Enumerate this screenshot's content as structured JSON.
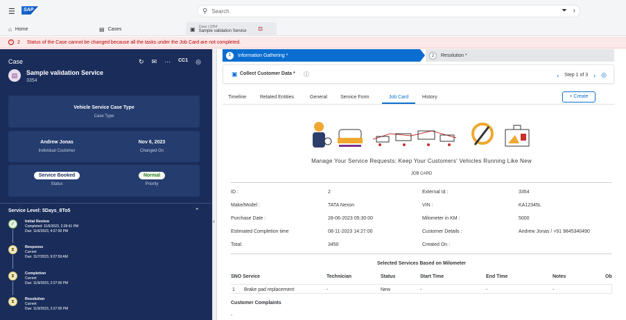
{
  "shell": {
    "search_placeholder": "Search",
    "logo": "SAP"
  },
  "tabs": [
    {
      "label": "Home",
      "icon": "home-icon"
    },
    {
      "label": "Cases",
      "icon": "cases-icon"
    },
    {
      "sub": "Case | 3354",
      "title": "Sample validation Service",
      "icon": "case-icon"
    }
  ],
  "error": {
    "count": "2",
    "message": "Status of the Case cannot be changed because all the tasks under the Job Card are not completed."
  },
  "case": {
    "header": "Case",
    "action_label": "CC1",
    "title": "Sample validation Service",
    "number": "3354",
    "type_value": "Vehicle Service Case Type",
    "type_label": "Case Type",
    "customer_value": "Andrew Jonas",
    "customer_label": "Individual Customer",
    "changed_value": "Nov 6, 2023",
    "changed_label": "Changed On",
    "status_value": "Service Booked",
    "status_label": "Status",
    "priority_value": "Normal",
    "priority_label": "Priority",
    "sla_title": "Service Level: 5Days_8To5",
    "steps": [
      {
        "name": "Initial Review",
        "l1": "Completed: 11/6/2023, 2:28:41 PM",
        "l2": "Due: 11/6/2023, 4:27:00 PM"
      },
      {
        "name": "Response",
        "l1": "Current",
        "l2": "Due: 11/7/2023, 9:27:59 AM"
      },
      {
        "name": "Completion",
        "l1": "Current",
        "l2": "Due: 11/9/2023, 2:27:00 PM"
      },
      {
        "name": "Resolution",
        "l1": "Current",
        "l2": "Due: 11/9/2023, 2:27:00 PM"
      }
    ]
  },
  "wizard": {
    "step1_num": "1",
    "step1": "Information Gathering *",
    "step2_num": "2",
    "step2": "Resolution *",
    "collect": "Collect Customer Data *",
    "step_of": "Step 1 of 3"
  },
  "subtabs": [
    "Timeline",
    "Related Entities",
    "General",
    "Service Form",
    "Job Card",
    "History"
  ],
  "create": "Create",
  "jobcard": {
    "headline": "Manage Your Service Requests: Keep Your Customers' Vehicles Running Like New",
    "label": "JOB CARD",
    "f": {
      "id_l": "ID :",
      "id_v": "2",
      "ext_l": "External Id :",
      "ext_v": "3354",
      "mm_l": "Make/Model :",
      "mm_v": "TATA Nexon",
      "vin_l": "VIN :",
      "vin_v": "KA12345L",
      "pd_l": "Purchase Date :",
      "pd_v": "28-06-2023 05:30:00",
      "km_l": "Milometer in KM :",
      "km_v": "5000",
      "ect_l": "Estimated Completion time",
      "ect_v": "08-11-2023 14:27:00",
      "cd_l": "Customer Details :",
      "cd_v": "Andrew Jonas / +91 9845340490",
      "tot_l": "Total:",
      "tot_v": "3450",
      "co_l": "Created On :"
    },
    "services_title": "Selected Services Based on Milometer",
    "cols": [
      "SNO Service",
      "Technician",
      "Status",
      "Start Time",
      "End Time",
      "Notes",
      "Ob"
    ],
    "row": {
      "sno": "1",
      "service": "Brake pad replacement",
      "tech": "-",
      "status": "New",
      "start": "-",
      "end": "-",
      "notes": "-"
    },
    "complaints": "Customer Complaints",
    "complaints_value": "-"
  }
}
